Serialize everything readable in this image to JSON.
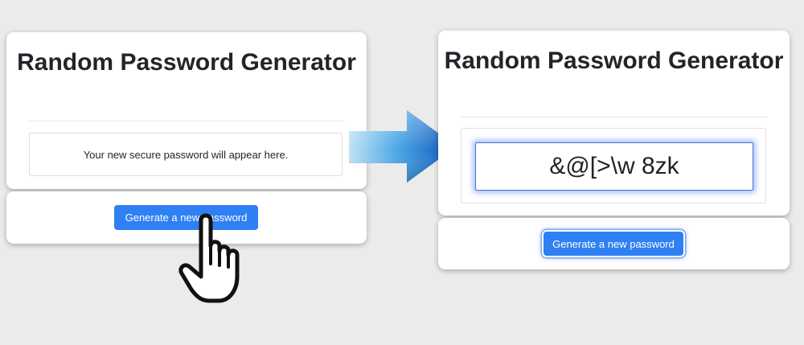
{
  "app": {
    "title": "Random Password Generator"
  },
  "before": {
    "title": "Random Password Generator",
    "placeholder": "Your new secure password will appear here.",
    "button_label": "Generate a new password"
  },
  "after": {
    "title": "Random Password Generator",
    "password": "&@[>\\w 8zk",
    "button_label": "Generate a new password"
  },
  "colors": {
    "button": "#2f80f3",
    "background": "#ebebeb",
    "arrow": "#1d6fd1",
    "focus_ring": "#7fa8f0"
  },
  "icons": {
    "arrow": "right-arrow-icon",
    "cursor": "pointing-hand-cursor-icon"
  }
}
